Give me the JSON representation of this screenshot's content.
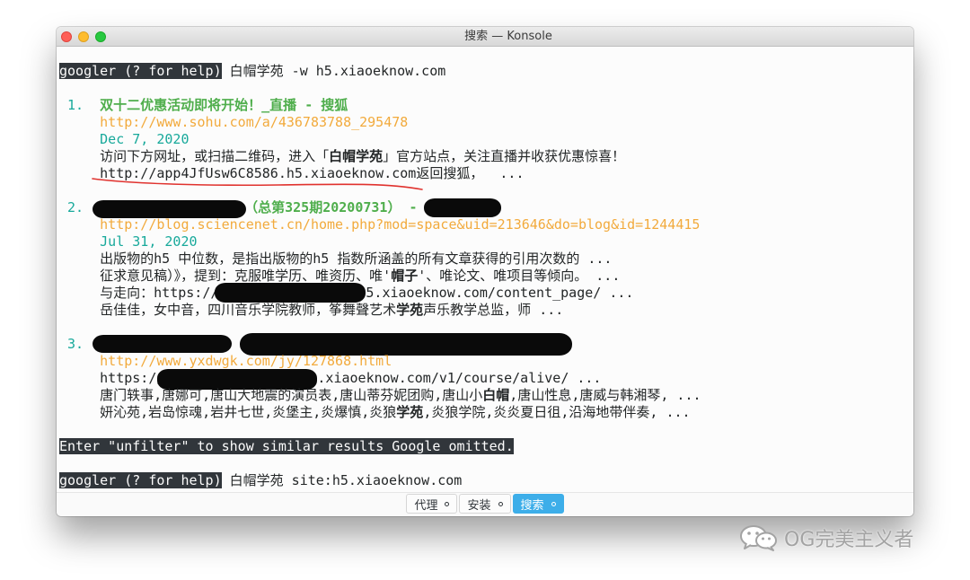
{
  "window": {
    "title": "搜索 — Konsole"
  },
  "terminal": {
    "prompt_label": "googler (? for help)",
    "first_command": " 白帽学苑 -w h5.xiaoeknow.com",
    "results": [
      {
        "index": "1.",
        "title": "双十二优惠活动即将开始！_直播 - 搜狐",
        "url": "http://www.sohu.com/a/436783788_295478",
        "date": "Dec 7, 2020",
        "abstract": [
          [
            {
              "text": "访问下方网址，或扫描二维码，进入「"
            },
            {
              "text": "白帽学苑",
              "bold": true
            },
            {
              "text": "」官方站点，关注直播并收获优惠惊喜！"
            }
          ],
          [
            {
              "text": "http://app4JfUsw6C8586.h5.xiaoeknow.com"
            },
            {
              "text": "返回搜狐，  ..."
            }
          ]
        ]
      },
      {
        "index": "2.",
        "title_redacted": true,
        "title_visible": "（总第325期20200731） -",
        "url": "http://blog.sciencenet.cn/home.php?mod=space&uid=213646&do=blog&id=1244415",
        "date": "Jul 31, 2020",
        "abstract": [
          [
            {
              "text": "出版物的h5 中位数，是指出版物的h5 指数所涵盖的所有文章获得的引用次数的 ..."
            }
          ],
          [
            {
              "text": "征求意见稿）》，提到：克服唯学历、唯资历、唯'"
            },
            {
              "text": "帽子",
              "bold": true
            },
            {
              "text": "'、唯论文、唯项目等倾向。 ..."
            }
          ],
          [
            {
              "text": "与走向：https://"
            },
            {
              "text": "5.xiaoeknow.com/content_page/ ..."
            }
          ],
          [
            {
              "text": "岳佳佳，女中音，四川音乐学院教师，筝舞聲艺术"
            },
            {
              "text": "学苑",
              "bold": true
            },
            {
              "text": "声乐教学总监，师 ..."
            }
          ]
        ]
      },
      {
        "index": "3.",
        "title_redacted": true,
        "url": "http://www.yxdwgk.com/jy/127868.html",
        "abstract": [
          [
            {
              "text": "https://"
            },
            {
              "text": ".xiaoeknow.com/v1/course/alive/ ..."
            }
          ],
          [
            {
              "text": "唐门轶事,唐娜可,唐山大地震的演员表,唐山蒂芬妮团购,唐山小"
            },
            {
              "text": "白帽",
              "bold": true
            },
            {
              "text": ",唐山性息,唐威与韩湘琴, ..."
            }
          ],
          [
            {
              "text": "妍沁苑,岩岛惊魂,岩井七世,炎堡主,炎爆慎,炎狼"
            },
            {
              "text": "学苑",
              "bold": true
            },
            {
              "text": ",炎狼学院,炎炎夏日徂,沿海地带伴奏, ..."
            }
          ]
        ]
      }
    ],
    "omitted_notice": "Enter \"unfilter\" to show similar results Google omitted.",
    "second_command": " 白帽学苑 site:h5.xiaoeknow.com"
  },
  "tabs": [
    {
      "label": "代理",
      "active": false
    },
    {
      "label": "安装",
      "active": false
    },
    {
      "label": "搜索",
      "active": true
    }
  ],
  "watermark": {
    "text": "OG完美主义者",
    "icon": "wechat-icon"
  },
  "icons": {
    "tab_indicator": "circle-icon",
    "watermark": "wechat-icon"
  },
  "colors": {
    "terminal_bg": "#fcfcfc",
    "text": "#232627",
    "inverse_bg": "#31363b",
    "index": "#18a99b",
    "title": "#4fae4c",
    "url": "#f2aa3c",
    "date": "#18a99b",
    "annotation": "#e0322e",
    "active_tab": "#3daee9",
    "redaction": "#0a0a0a"
  }
}
